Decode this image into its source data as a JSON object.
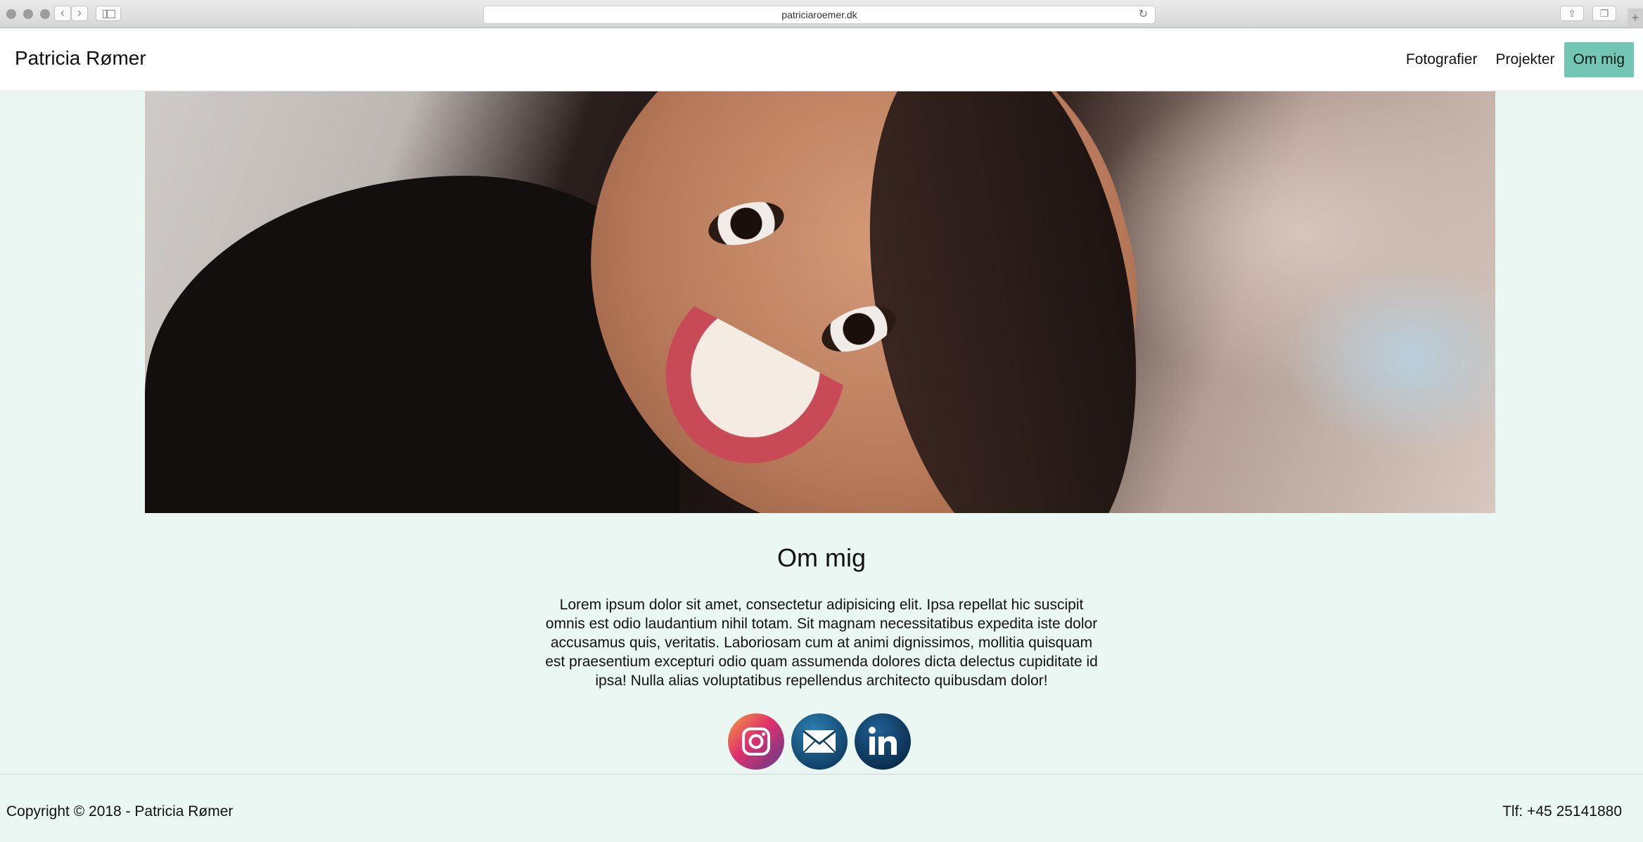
{
  "browser": {
    "url": "patriciaroemer.dk"
  },
  "site": {
    "brand": "Patricia Rømer",
    "nav": [
      {
        "label": "Fotografier"
      },
      {
        "label": "Projekter"
      },
      {
        "label": "Om mig",
        "active": true
      }
    ]
  },
  "about": {
    "title": "Om mig",
    "text": "Lorem ipsum dolor sit amet, consectetur adipisicing elit. Ipsa repellat hic suscipit omnis est odio laudantium nihil totam. Sit magnam necessitatibus expedita iste dolor accusamus quis, veritatis. Laboriosam cum at animi dignissimos, mollitia quisquam est praesentium excepturi odio quam assumenda dolores dicta delectus cupiditate id ipsa! Nulla alias voluptatibus repellendus architecto quibusdam dolor!"
  },
  "social": [
    {
      "name": "instagram-icon"
    },
    {
      "name": "email-icon"
    },
    {
      "name": "linkedin-icon"
    }
  ],
  "footer": {
    "copyright": "Copyright © 2018 - Patricia Rømer",
    "phone": "Tlf: +45 25141880"
  },
  "colors": {
    "page_background": "#eaf7f3",
    "nav_active": "#73c6b4"
  }
}
